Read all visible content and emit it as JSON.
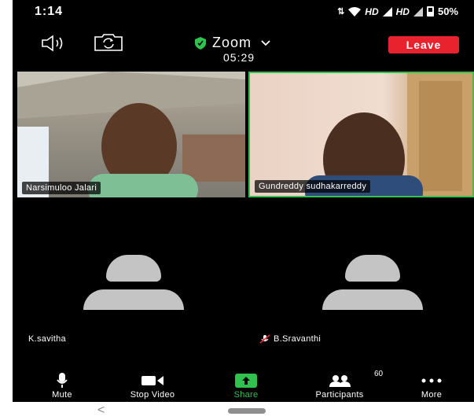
{
  "status_bar": {
    "time": "1:14",
    "hd1": "HD",
    "hd2": "HD",
    "battery": "50%"
  },
  "meeting": {
    "title": "Zoom",
    "timer": "05:29",
    "leave_label": "Leave"
  },
  "participants": [
    {
      "name": "Narsimuloo Jalari",
      "video": true
    },
    {
      "name": "Gundreddy sudhakarreddy",
      "video": true,
      "active_speaker": true
    },
    {
      "name": "K.savitha",
      "video": false
    },
    {
      "name": "B.Sravanthi",
      "video": false,
      "muted": true
    }
  ],
  "toolbar": {
    "mute_label": "Mute",
    "video_label": "Stop Video",
    "share_label": "Share",
    "participants_label": "Participants",
    "participants_count": "60",
    "more_label": "More"
  },
  "colors": {
    "leave": "#e8232d",
    "share": "#2fc24f",
    "active_border": "#33c24d",
    "avatar": "#c4c4c4"
  },
  "icons": {
    "speaker": "speaker-icon",
    "camera_switch": "switch-camera-icon",
    "shield": "shield-icon",
    "mic": "mic-icon",
    "video": "video-icon",
    "share": "share-arrow-icon",
    "participants": "participants-icon",
    "more": "more-dots-icon"
  }
}
